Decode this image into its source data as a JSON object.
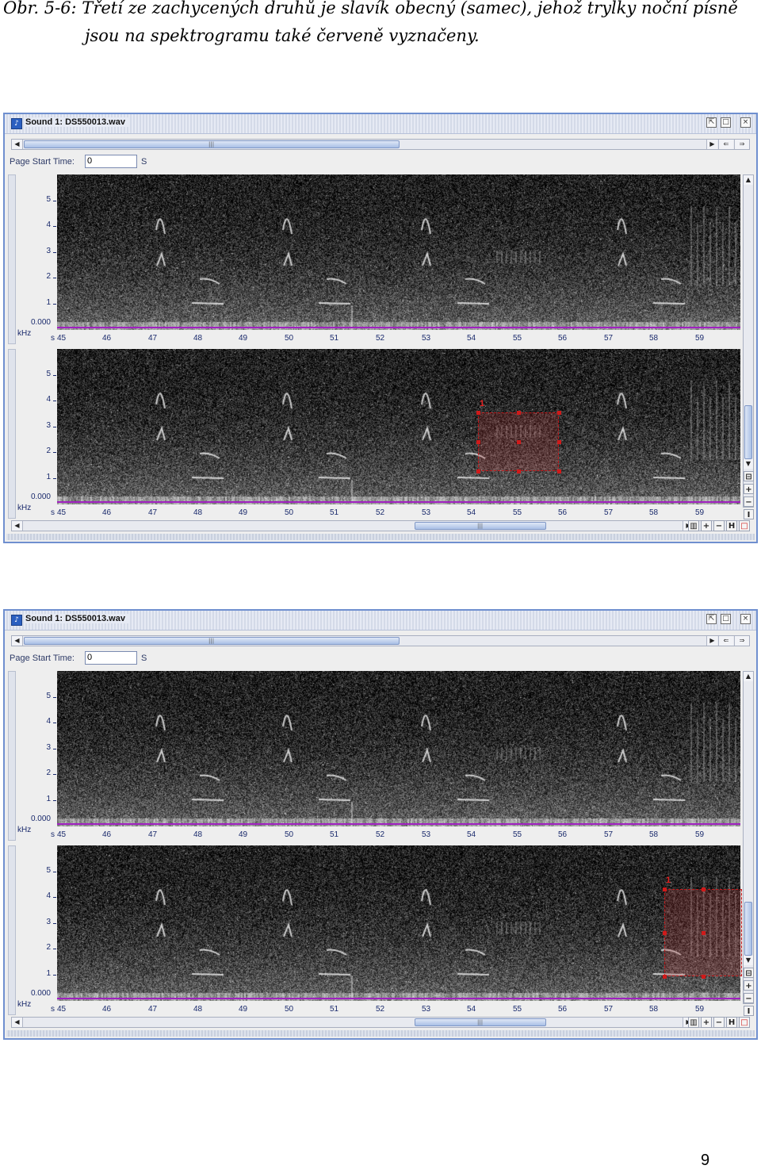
{
  "caption": {
    "line1": "Obr. 5-6: Třetí ze zachycených druhů je slavík obecný (samec), jehož trylky noční písně",
    "line2": "jsou na spektrogramu také červeně vyznačeny."
  },
  "window": {
    "title": "Sound 1: DS550013.wav",
    "page_start_label": "Page Start Time:",
    "page_start_value": "0",
    "page_start_unit": "S"
  },
  "spectrogram": {
    "y_unit": "kHz",
    "y_ticks": [
      "5",
      "4",
      "3",
      "2",
      "1"
    ],
    "y_zero": "0.000",
    "x_unit": "s",
    "x_ticks": [
      "45",
      "46",
      "47",
      "48",
      "49",
      "50",
      "51",
      "52",
      "53",
      "54",
      "55",
      "56",
      "57",
      "58",
      "59"
    ]
  },
  "selection_label": "1",
  "colors": {
    "selection": "#c0181a",
    "axis": "#a020c0",
    "frame": "#6f8fcf"
  },
  "page_number": "9"
}
